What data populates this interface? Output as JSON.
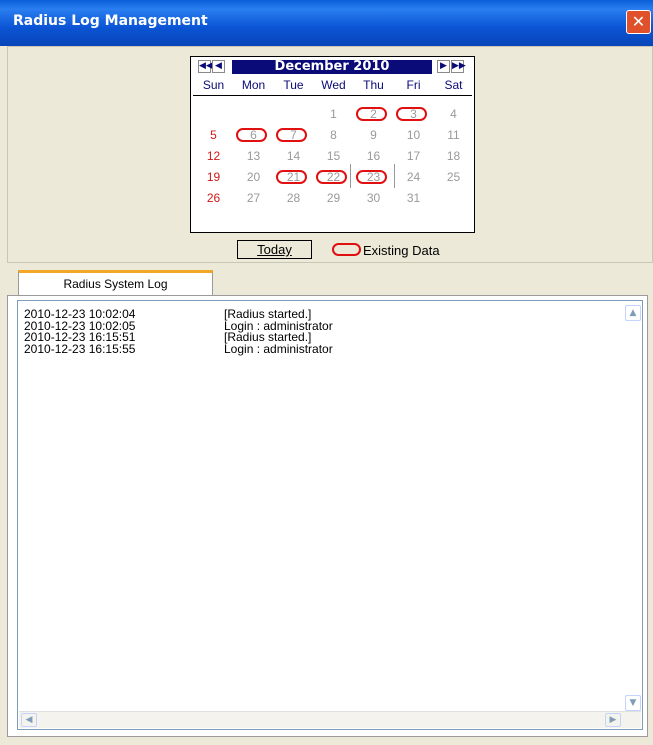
{
  "window": {
    "title": "Radius Log Management",
    "close_glyph": "✕"
  },
  "calendar": {
    "month_label": "December 2010",
    "nav": {
      "prev_year": "◀◀",
      "prev_month": "◀",
      "next_month": "▶",
      "next_year": "▶▶"
    },
    "weekdays": [
      "Sun",
      "Mon",
      "Tue",
      "Wed",
      "Thu",
      "Fri",
      "Sat"
    ],
    "days": [
      "1",
      "2",
      "3",
      "4",
      "5",
      "6",
      "7",
      "8",
      "9",
      "10",
      "11",
      "12",
      "13",
      "14",
      "15",
      "16",
      "17",
      "18",
      "19",
      "20",
      "21",
      "22",
      "23",
      "24",
      "25",
      "26",
      "27",
      "28",
      "29",
      "30",
      "31"
    ],
    "marked_days": [
      2,
      3,
      6,
      7,
      21,
      22,
      23
    ],
    "today": 23,
    "colors": {
      "header_bg": "#0a0a78",
      "sunday": "#d01818",
      "mark": "#e01010",
      "day": "#9a9a9a"
    }
  },
  "footer": {
    "today_button": "Today",
    "legend_label": "Existing Data"
  },
  "tabs": [
    {
      "label": "Radius System Log",
      "active": true
    }
  ],
  "log": {
    "rows": [
      {
        "time": "2010-12-23 10:02:04",
        "message": "[Radius started.]"
      },
      {
        "time": "2010-12-23 10:02:05",
        "message": "Login : administrator"
      },
      {
        "time": "2010-12-23 16:15:51",
        "message": "[Radius started.]"
      },
      {
        "time": "2010-12-23 16:15:55",
        "message": "Login : administrator"
      }
    ]
  },
  "scroll_glyphs": {
    "up": "▲",
    "down": "▼",
    "left": "◀",
    "right": "▶"
  }
}
